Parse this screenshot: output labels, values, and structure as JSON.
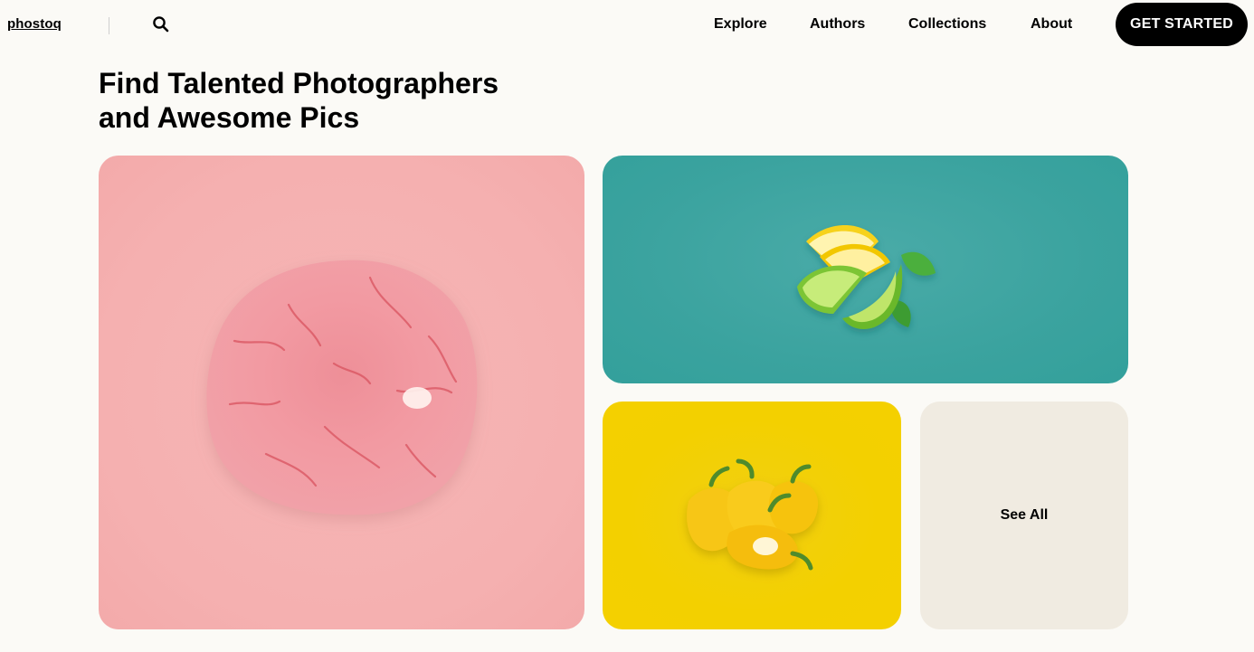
{
  "header": {
    "logo": "phostoq",
    "search_icon": "search-icon",
    "nav": [
      {
        "label": "Explore"
      },
      {
        "label": "Authors"
      },
      {
        "label": "Collections"
      },
      {
        "label": "About"
      }
    ],
    "cta_label": "GET STARTED"
  },
  "hero": {
    "title_line1": "Find Talented Photographers",
    "title_line2": "and Awesome Pics"
  },
  "gallery": {
    "see_all_label": "See All",
    "colors": {
      "pink": "#f5b3b3",
      "teal": "#3ca39f",
      "yellow": "#f3d000",
      "cream": "#f0ebe1"
    }
  }
}
